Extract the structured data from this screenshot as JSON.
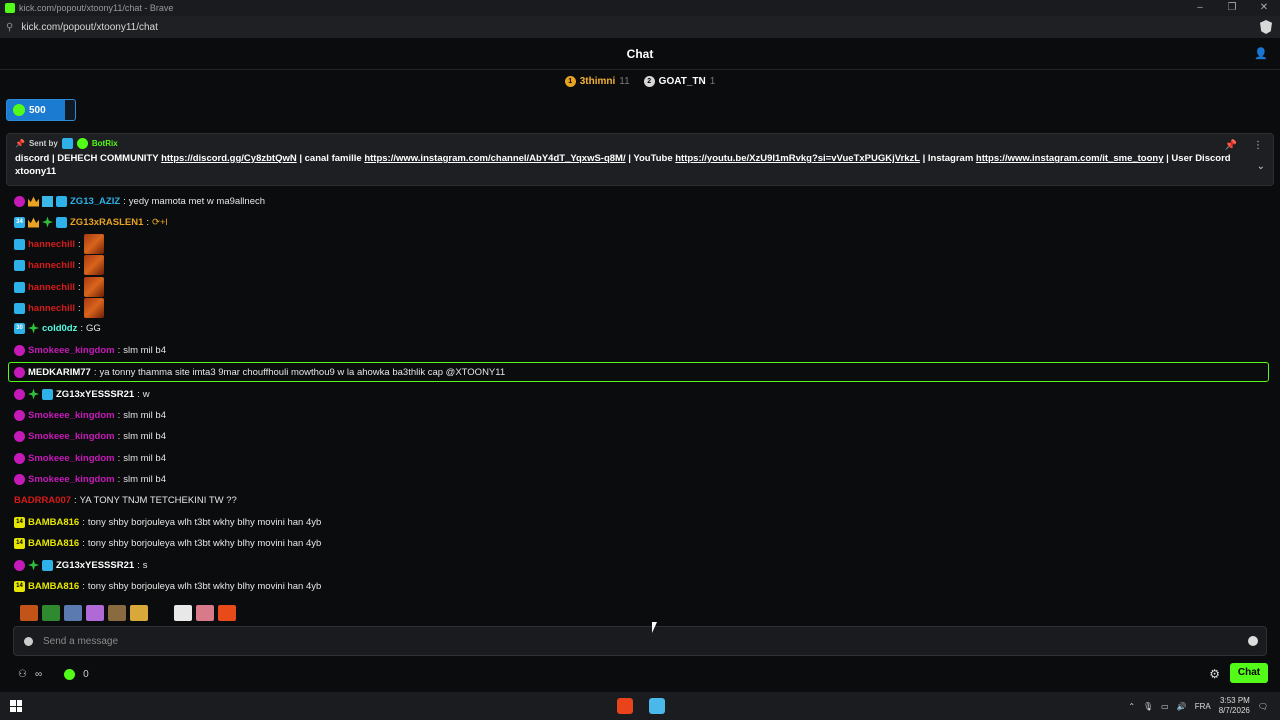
{
  "window": {
    "title": "kick.com/popout/xtoony11/chat - Brave",
    "url": "kick.com/popout/xtoony11/chat"
  },
  "header": {
    "title": "Chat"
  },
  "leaderboard": [
    {
      "rank": "1",
      "name": "3thimni",
      "count": "11"
    },
    {
      "rank": "2",
      "name": "GOAT_TN",
      "count": "1"
    }
  ],
  "gift": {
    "amount": "500"
  },
  "pinned": {
    "sent_by_label": "Sent by",
    "bot_name": "BotRix",
    "text_parts": [
      "discord | DEHECH COMMUNITY ",
      "https://discord.gg/Cy8zbtQwN",
      " | canal famille ",
      "https://www.instagram.com/channel/AbY4dT_YqxwS-q8M/",
      " | YouTube ",
      "https://youtu.be/XzU9I1mRvkg?si=vVueTxPUGKjVrkzL",
      " | Instagram ",
      "https://www.instagram.com/it_sme_toony",
      " | User Discord",
      "xtoony11"
    ]
  },
  "messages": [
    {
      "user": "ZG13_AZIZ",
      "color": "#2eb0e8",
      "text": "yedy mamota met w ma9allnech"
    },
    {
      "user": "ZG13xRASLEN1",
      "color": "#e8a323",
      "text": "",
      "badge_num": "34"
    },
    {
      "user": "hannechill",
      "color": "#d81a1a",
      "text": ""
    },
    {
      "user": "hannechill",
      "color": "#d81a1a",
      "text": ""
    },
    {
      "user": "hannechill",
      "color": "#d81a1a",
      "text": ""
    },
    {
      "user": "hannechill",
      "color": "#d81a1a",
      "text": ""
    },
    {
      "user": "cold0dz",
      "color": "#53fce0",
      "text": "GG",
      "badge_num": "30"
    },
    {
      "user": "Smokeee_kingdom",
      "color": "#c61ab8",
      "text": "slm mil b4"
    },
    {
      "user": "MEDKARIM77",
      "color": "#ffffff",
      "text": "ya tonny thamma site imta3 9mar chouffhouli mowthou9 w la ahowka ba3thlik cap @XTOONY11"
    },
    {
      "user": "ZG13xYESSSR21",
      "color": "#ffffff",
      "text": "w"
    },
    {
      "user": "Smokeee_kingdom",
      "color": "#c61ab8",
      "text": "slm mil b4"
    },
    {
      "user": "Smokeee_kingdom",
      "color": "#c61ab8",
      "text": "slm mil b4"
    },
    {
      "user": "Smokeee_kingdom",
      "color": "#c61ab8",
      "text": "slm mil b4"
    },
    {
      "user": "Smokeee_kingdom",
      "color": "#c61ab8",
      "text": "slm mil b4"
    },
    {
      "user": "BADRRA007",
      "color": "#d81a1a",
      "text": "YA TONY TNJM TETCHEKINI TW ??"
    },
    {
      "user": "BAMBA816",
      "color": "#e6e600",
      "text": "tony shby borjouleya wlh t3bt wkhy blhy movini han 4yb",
      "badge_num": "14"
    },
    {
      "user": "BAMBA816",
      "color": "#e6e600",
      "text": "tony shby borjouleya wlh t3bt wkhy blhy movini han 4yb",
      "badge_num": "14"
    },
    {
      "user": "ZG13xYESSSR21",
      "color": "#ffffff",
      "text": "s"
    },
    {
      "user": "BAMBA816",
      "color": "#e6e600",
      "text": "tony shby borjouleya wlh t3bt wkhy blhy movini han 4yb",
      "badge_num": "14"
    }
  ],
  "input": {
    "placeholder": "Send a message"
  },
  "footer": {
    "infinity": "∞",
    "points": "0",
    "chat_button": "Chat"
  },
  "taskbar": {
    "lang": "FRA",
    "time": "3:53 PM",
    "date": "8/7/2026"
  }
}
